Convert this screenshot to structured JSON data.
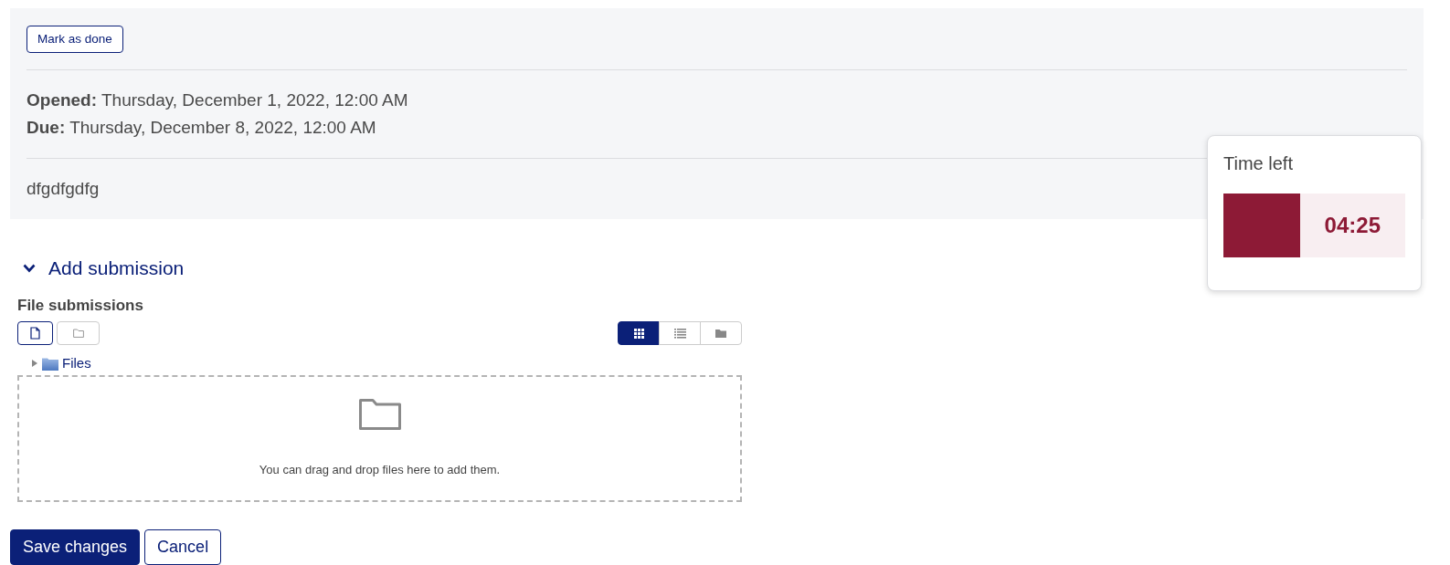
{
  "activity_header": {
    "mark_done_button": "Mark as done",
    "dates": [
      "**Opened:** Thursday, December 1, 2022, 12:00 AM",
      "**Due:** Thursday, December 8, 2022, 12:00 AM"
    ],
    "description": "dfgdfgdfg"
  },
  "timer": {
    "title": "Time left",
    "level": 0.42,
    "reading": "04:25"
  },
  "submission": {
    "heading": "Add submission",
    "expanded": true,
    "field_label": "File submissions",
    "action_buttons": [
      {
        "kind": "add-file",
        "disabled": false
      },
      {
        "kind": "create-folder",
        "disabled": true
      }
    ],
    "view_buttons": [
      {
        "kind": "icons",
        "selected": true
      },
      {
        "kind": "list",
        "selected": false
      },
      {
        "kind": "tree",
        "selected": false
      }
    ],
    "tree": [
      {
        "label": "Files",
        "expanded": false
      }
    ],
    "dropzone": {
      "message": "You can drag and drop files here to add them."
    }
  },
  "buttons": [
    {
      "label": "Save changes",
      "kind": "primary"
    },
    {
      "label": "Cancel",
      "kind": "secondary"
    }
  ]
}
